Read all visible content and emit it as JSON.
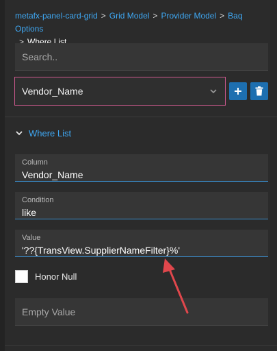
{
  "breadcrumb": {
    "items": [
      "metafx-panel-card-grid",
      "Grid Model",
      "Provider Model",
      "Baq Options"
    ],
    "separator": ">",
    "current": "Where List"
  },
  "search": {
    "placeholder": "Search.."
  },
  "selector": {
    "value": "Vendor_Name"
  },
  "section": {
    "title": "Where List"
  },
  "fields": {
    "column": {
      "label": "Column",
      "value": "Vendor_Name"
    },
    "condition": {
      "label": "Condition",
      "value": "like"
    },
    "value": {
      "label": "Value",
      "value": "'??{TransView.SupplierNameFilter}%'"
    }
  },
  "honor_null": {
    "label": "Honor Null",
    "checked": false
  },
  "empty_value": {
    "placeholder": "Empty Value"
  },
  "colors": {
    "accent": "#3fa9f5",
    "button": "#1d6fb0",
    "annotation_arrow": "#e0474c",
    "focus_border": "#d05a90"
  },
  "icons": [
    "chevron-down-icon",
    "plus-icon",
    "trash-icon",
    "chevron-down-icon"
  ]
}
